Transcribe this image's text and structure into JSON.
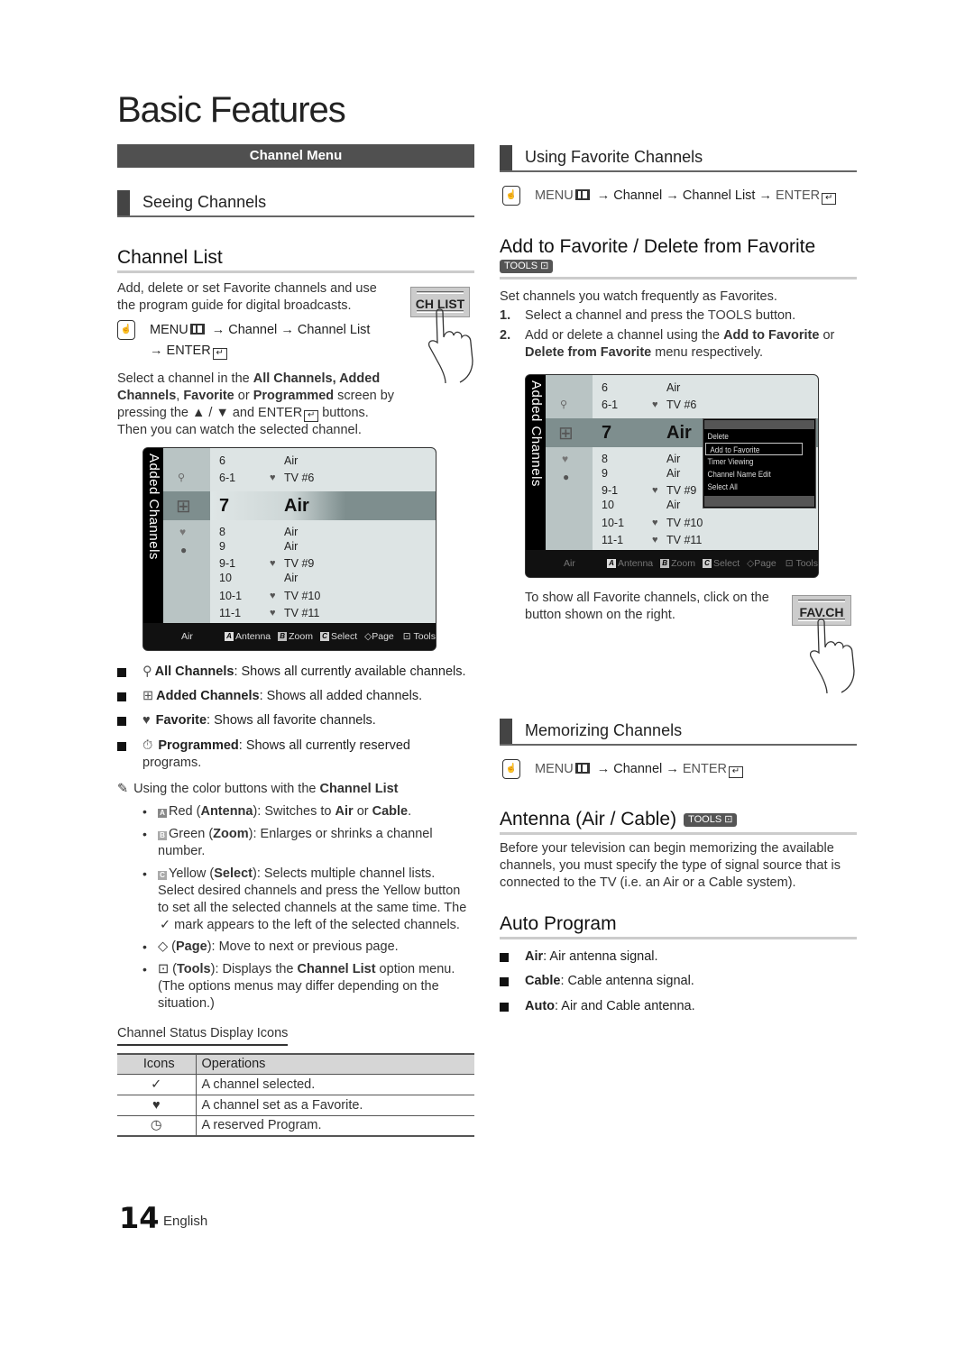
{
  "page": {
    "title": "Basic Features",
    "page_number": "14",
    "language": "English"
  },
  "left": {
    "banner": "Channel Menu",
    "section_title": "Seeing Channels",
    "channel_list": {
      "heading": "Channel List",
      "intro_1": "Add, delete or set Favorite channels and use",
      "intro_2": "the program guide for digital broadcasts.",
      "remote_button": "CH LIST",
      "menu_path": {
        "menu": "MENU",
        "arrow": "→",
        "channel": "Channel",
        "channel_list": "Channel List",
        "enter": "ENTER"
      },
      "select_text": {
        "l1a": "Select a channel in the ",
        "l1b": "All Channels, Added",
        "l2a": "Channels",
        "l2b": ", ",
        "l2c": "Favorite",
        "l2d": " or ",
        "l2e": "Programmed",
        "l2f": " screen by",
        "l3a": "pressing the ▲ / ▼ and ENTER",
        "l3b": " buttons.",
        "l4": "Then you can watch the selected channel."
      }
    },
    "tv": {
      "side_label": "Added Channels",
      "rows_top": [
        {
          "num": "6",
          "fav": "",
          "name": "Air"
        },
        {
          "num": "6-1",
          "fav": "♥",
          "name": "TV #6"
        }
      ],
      "selected": {
        "num": "7",
        "name": "Air"
      },
      "rows_bottom": [
        {
          "num": "8",
          "fav": "",
          "name": "Air"
        },
        {
          "num": "9",
          "fav": "",
          "name": "Air"
        },
        {
          "num": "9-1",
          "fav": "♥",
          "name": "TV #9"
        },
        {
          "num": "10",
          "fav": "",
          "name": "Air"
        },
        {
          "num": "10-1",
          "fav": "♥",
          "name": "TV #10"
        },
        {
          "num": "11-1",
          "fav": "♥",
          "name": "TV #11"
        }
      ],
      "bar": {
        "antenna_mode": "Air",
        "key_a": "A",
        "antenna": "Antenna",
        "key_b": "B",
        "zoom": "Zoom",
        "key_c": "C",
        "select": "Select",
        "page_icon": "◇",
        "page": "Page",
        "tools": "Tools"
      }
    },
    "categories": [
      {
        "name": "All Channels",
        "desc": ": Shows all currently available channels."
      },
      {
        "name": "Added Channels",
        "desc": ": Shows all added channels."
      },
      {
        "name": "Favorite",
        "desc": ": Shows all favorite channels."
      },
      {
        "name": "Programmed",
        "desc": ": Shows all currently reserved",
        "desc2": "programs."
      }
    ],
    "note": {
      "intro_a": "Using the color buttons with the ",
      "intro_b": "Channel List",
      "red": {
        "key": "A",
        "a": "Red (",
        "b": "Antenna",
        "c": "): Switches to ",
        "d": "Air",
        "e": " or ",
        "f": "Cable",
        "g": "."
      },
      "green": {
        "key": "B",
        "a": "Green (",
        "b": "Zoom",
        "c": "): Enlarges or shrinks a channel",
        "d": "number."
      },
      "yellow": {
        "key": "C",
        "a": "Yellow (",
        "b": "Select",
        "c": "): Selects multiple channel lists.",
        "d": "Select desired channels and press the Yellow button",
        "e": "to set all the selected channels at the same time. The",
        "f": " mark appears to the left of the selected channels."
      },
      "page": {
        "a": " (",
        "b": "Page",
        "c": "): Move to next or previous page."
      },
      "tools": {
        "a": " (",
        "b": "Tools",
        "c": "): Displays the ",
        "d": "Channel List",
        "e": " option menu.",
        "f": "(The options menus may differ depending on the",
        "g": "situation.)"
      }
    },
    "status_icons": {
      "title": "Channel Status Display Icons",
      "headers": [
        "Icons",
        "Operations"
      ],
      "rows": [
        {
          "icon": "✓",
          "icon_name": "checkmark-icon",
          "text": "A channel selected."
        },
        {
          "icon": "♥",
          "icon_name": "heart-icon",
          "text": "A channel set as a Favorite."
        },
        {
          "icon": "◷",
          "icon_name": "clock-icon",
          "text": "A reserved Program."
        }
      ]
    }
  },
  "right": {
    "fav_section": "Using Favorite Channels",
    "fav_menu_path": {
      "menu": "MENU",
      "arrow": "→",
      "channel": "Channel",
      "channel_list": "Channel List",
      "enter": "ENTER"
    },
    "add_fav": {
      "heading": "Add to Favorite / Delete from Favorite",
      "tools_badge": "TOOLS",
      "intro": "Set channels you watch frequently as Favorites.",
      "step1": {
        "n": "1.",
        "a": "Select a channel and press the ",
        "b": "TOOLS",
        "c": " button."
      },
      "step2": {
        "n": "2.",
        "a": "Add or delete a channel using the ",
        "b": "Add to Favorite",
        "c": " or",
        "d": "Delete from Favorite",
        "e": " menu respectively."
      }
    },
    "tv": {
      "side_label": "Added Channels",
      "rows_top": [
        {
          "num": "6",
          "fav": "",
          "name": "Air"
        },
        {
          "num": "6-1",
          "fav": "♥",
          "name": "TV #6"
        }
      ],
      "selected": {
        "num": "7",
        "name": "Air"
      },
      "rows_bottom": [
        {
          "num": "8",
          "fav": "",
          "name": "Air"
        },
        {
          "num": "9",
          "fav": "",
          "name": "Air"
        },
        {
          "num": "9-1",
          "fav": "♥",
          "name": "TV #9"
        },
        {
          "num": "10",
          "fav": "",
          "name": "Air"
        },
        {
          "num": "10-1",
          "fav": "♥",
          "name": "TV #10"
        },
        {
          "num": "11-1",
          "fav": "♥",
          "name": "TV #11"
        }
      ],
      "popup": [
        "Delete",
        "Add to Favorite",
        "Timer Viewing",
        "Channel Name Edit",
        "Select All"
      ],
      "popup_selected": "Add to Favorite",
      "bar": {
        "antenna_mode": "Air",
        "key_a": "A",
        "antenna": "Antenna",
        "key_b": "B",
        "zoom": "Zoom",
        "key_c": "C",
        "select": "Select",
        "page_icon": "◇",
        "page": "Page",
        "tools": "Tools"
      }
    },
    "fav_show_1": "To show all Favorite channels, click on the",
    "fav_show_2": "button shown on the right.",
    "fav_button": "FAV.CH",
    "mem_section": "Memorizing Channels",
    "mem_menu_path": {
      "menu": "MENU",
      "arrow": "→",
      "channel": "Channel",
      "enter": "ENTER"
    },
    "antenna": {
      "heading": "Antenna (Air / Cable)",
      "tools_badge": "TOOLS",
      "p1": "Before your television can begin memorizing the available",
      "p2": "channels, you must specify the type of signal source that is",
      "p3": "connected to the TV (i.e. an Air or a Cable system)."
    },
    "auto_program": {
      "heading": "Auto Program",
      "items": [
        {
          "name": "Air",
          "desc": ": Air antenna signal."
        },
        {
          "name": "Cable",
          "desc": ": Cable antenna signal."
        },
        {
          "name": "Auto",
          "desc": ": Air and Cable antenna."
        }
      ]
    }
  }
}
